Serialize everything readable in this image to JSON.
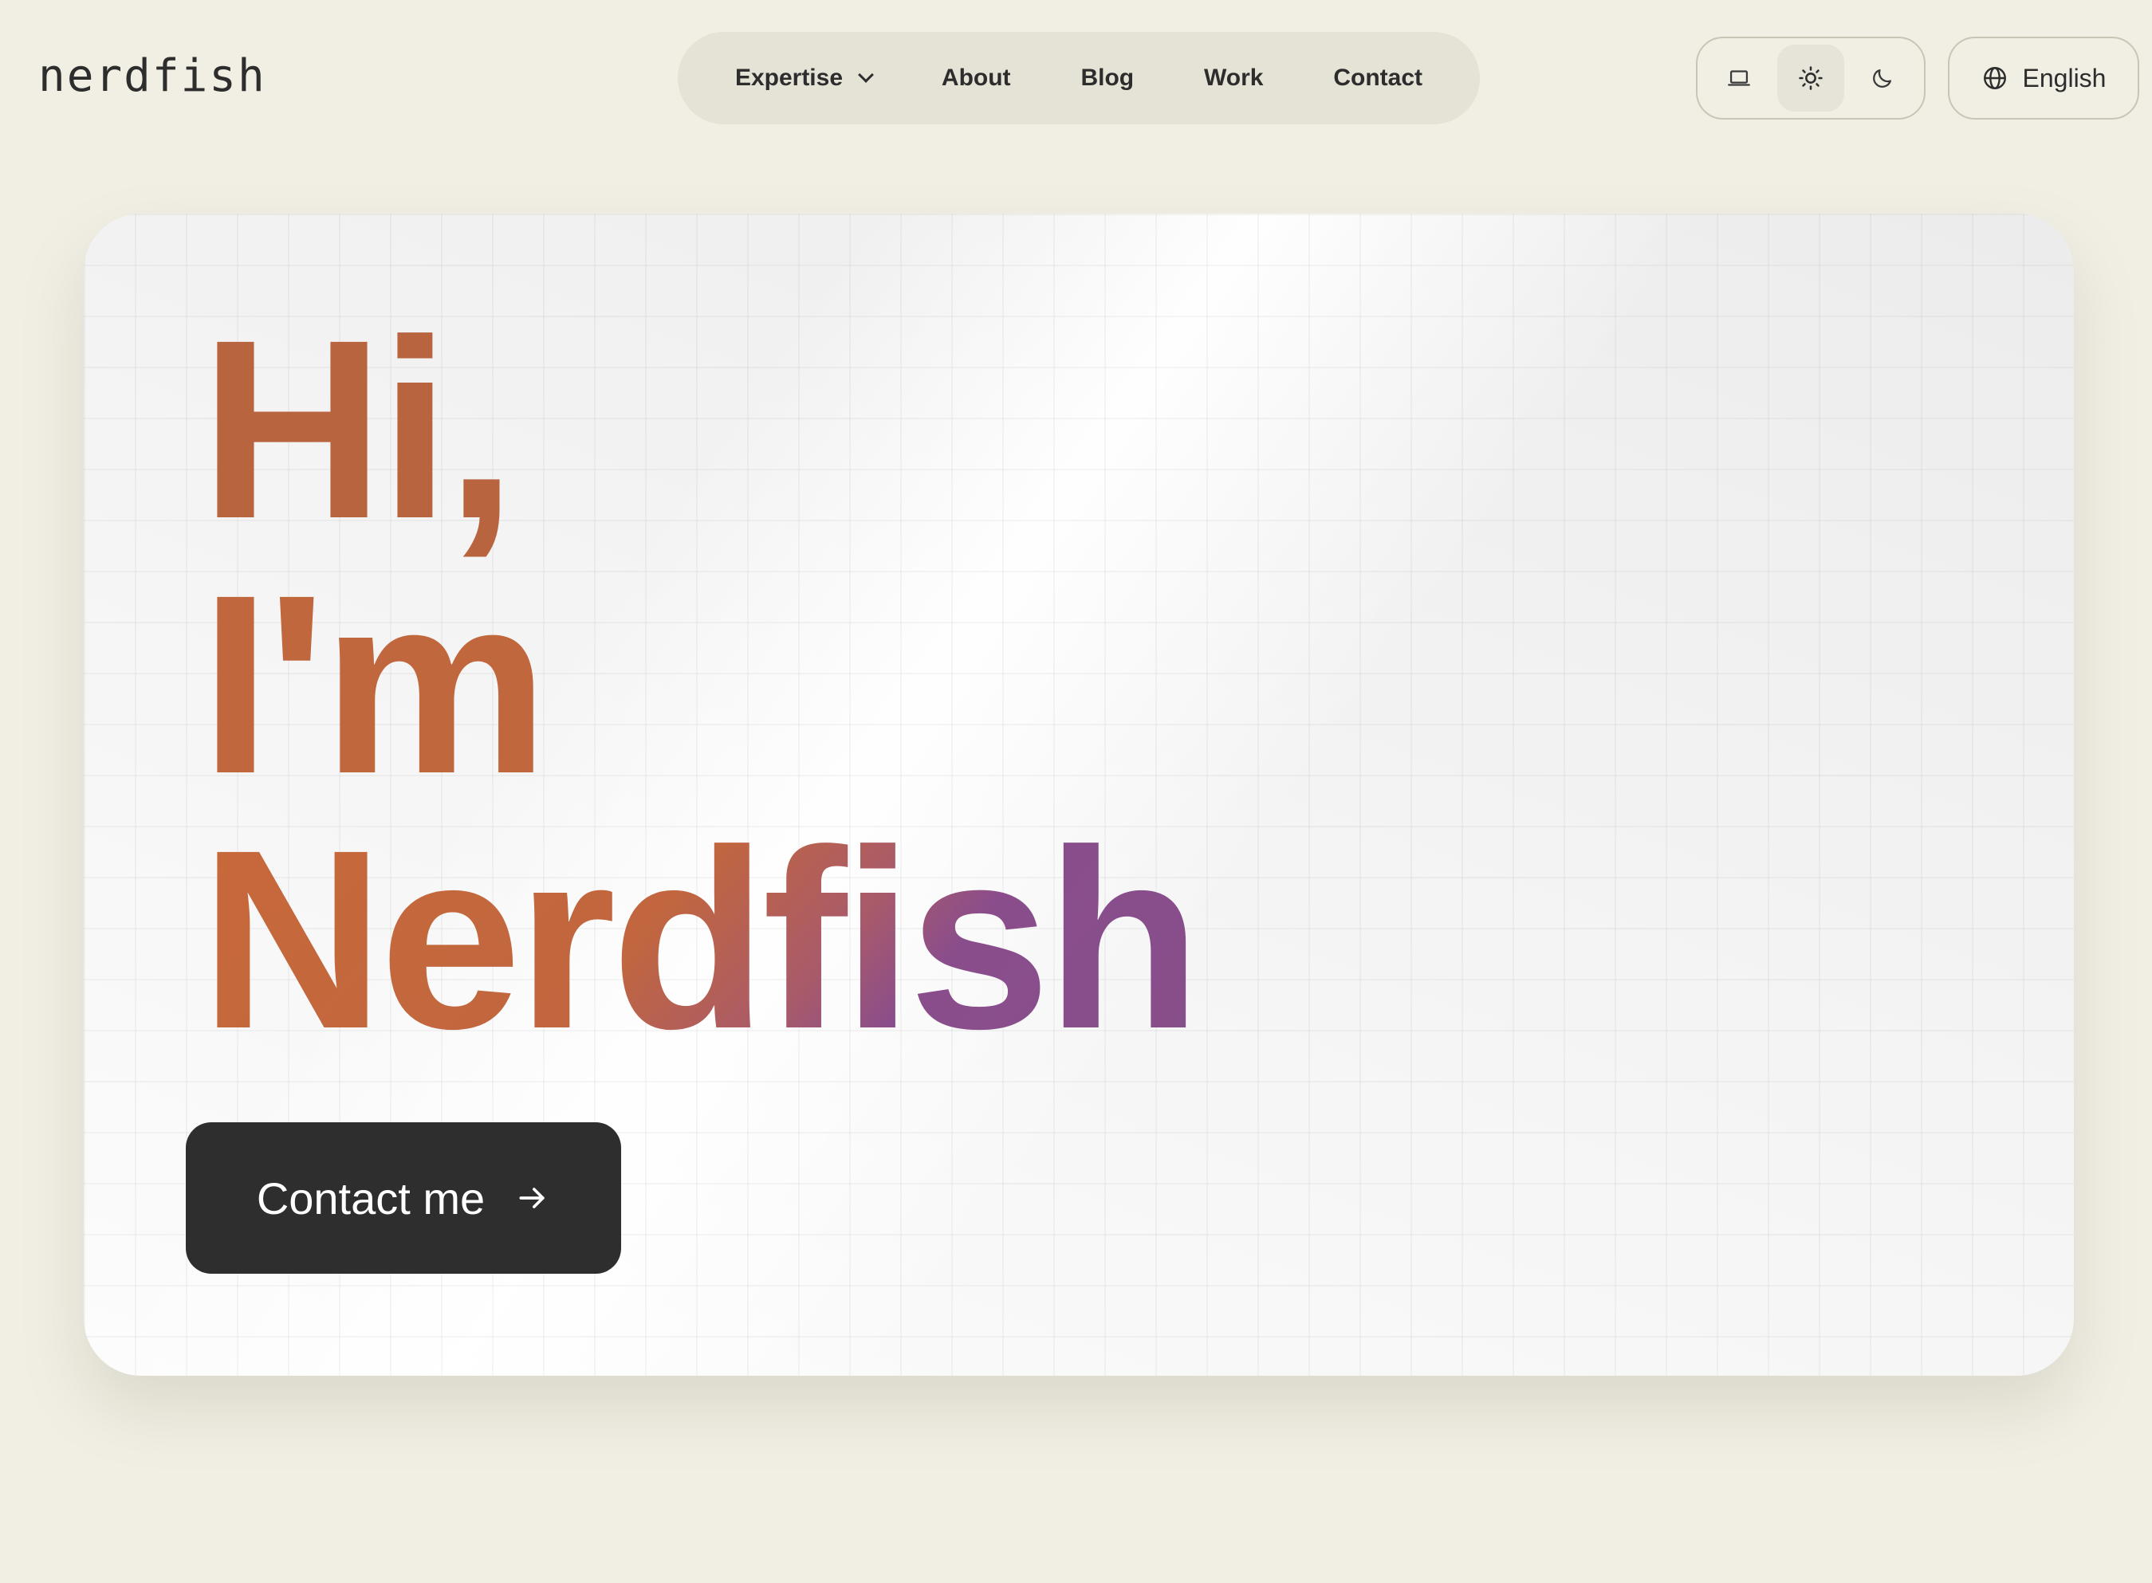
{
  "header": {
    "logo": "nerdfish",
    "nav": [
      {
        "label": "Expertise",
        "has_dropdown": true
      },
      {
        "label": "About"
      },
      {
        "label": "Blog"
      },
      {
        "label": "Work"
      },
      {
        "label": "Contact"
      }
    ],
    "theme_options": [
      {
        "icon": "laptop-icon",
        "selected": false
      },
      {
        "icon": "sun-icon",
        "selected": true
      },
      {
        "icon": "moon-icon",
        "selected": false
      }
    ],
    "language": {
      "label": "English",
      "icon": "globe-icon"
    }
  },
  "hero": {
    "line1": "Hi,",
    "line2": "I'm",
    "line3": "Nerdfish",
    "cta_label": "Contact me",
    "cta_icon": "arrow-right-icon"
  },
  "colors": {
    "background": "#f1efe4",
    "orange": "#c0673e",
    "purple": "#864f8a",
    "cta_bg": "#2e2e2e"
  }
}
